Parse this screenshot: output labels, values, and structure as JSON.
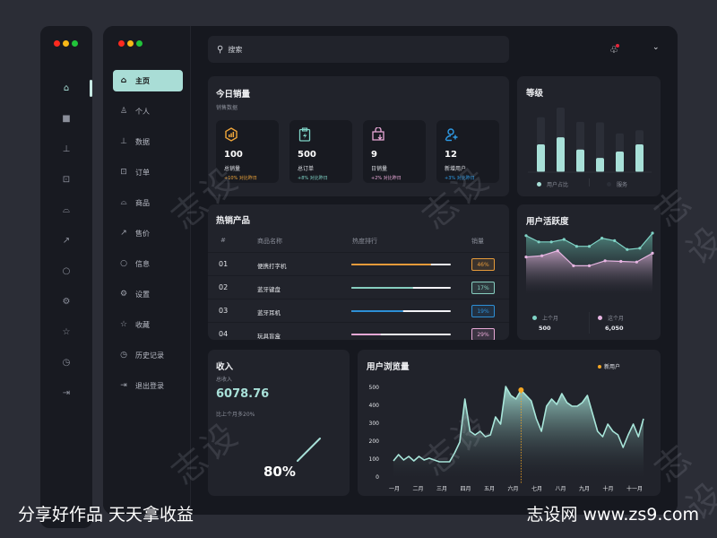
{
  "window_controls": {
    "colors": [
      "#ff2a1f",
      "#f7b817",
      "#21c43a"
    ]
  },
  "mini_sidebar": {
    "items": [
      {
        "icon": "home-icon",
        "glyph": "⌂",
        "active": true
      },
      {
        "icon": "square-icon",
        "glyph": "■"
      },
      {
        "icon": "chart-bar-icon",
        "glyph": "⊥"
      },
      {
        "icon": "cart-icon",
        "glyph": "⊡"
      },
      {
        "icon": "bag-icon",
        "glyph": "⌓"
      },
      {
        "icon": "line-chart-icon",
        "glyph": "↗"
      },
      {
        "icon": "message-icon",
        "glyph": "○"
      },
      {
        "icon": "settings-icon",
        "glyph": "⚙"
      },
      {
        "icon": "star-icon",
        "glyph": "☆"
      },
      {
        "icon": "history-icon",
        "glyph": "◷"
      },
      {
        "icon": "logout-icon",
        "glyph": "⇥"
      }
    ]
  },
  "sidebar": {
    "items": [
      {
        "label": "主页",
        "icon": "home-icon",
        "glyph": "⌂",
        "active": true
      },
      {
        "label": "个人",
        "icon": "user-icon",
        "glyph": "♙"
      },
      {
        "label": "数据",
        "icon": "chart-bar-icon",
        "glyph": "⊥"
      },
      {
        "label": "订单",
        "icon": "cart-icon",
        "glyph": "⊡"
      },
      {
        "label": "商品",
        "icon": "bag-icon",
        "glyph": "⌓"
      },
      {
        "label": "售价",
        "icon": "line-chart-icon",
        "glyph": "↗"
      },
      {
        "label": "信息",
        "icon": "message-icon",
        "glyph": "○"
      },
      {
        "label": "设置",
        "icon": "settings-icon",
        "glyph": "⚙"
      },
      {
        "label": "收藏",
        "icon": "star-icon",
        "glyph": "☆"
      },
      {
        "label": "历史记录",
        "icon": "history-icon",
        "glyph": "◷"
      },
      {
        "label": "退出登录",
        "icon": "logout-icon",
        "glyph": "⇥"
      }
    ]
  },
  "topbar": {
    "search_placeholder": "搜索",
    "search_glyph": "⚲",
    "bell_glyph": "🔔",
    "chevron_glyph": "⌄"
  },
  "today_sales": {
    "title": "今日销量",
    "subtitle": "销售数据",
    "stats": [
      {
        "value": "100",
        "label": "总销量",
        "change": "+10% 对比昨日",
        "color": "#f0a63a",
        "icon": "hexagon-chart-icon"
      },
      {
        "value": "500",
        "label": "总订单",
        "change": "+8% 对比昨日",
        "color": "#7fd3c6",
        "icon": "clipboard-bolt-icon"
      },
      {
        "value": "9",
        "label": "日销量",
        "change": "+2% 对比昨日",
        "color": "#e9a9d8",
        "icon": "shopping-bag-icon"
      },
      {
        "value": "12",
        "label": "新增用户",
        "change": "+3% 对比昨日",
        "color": "#2e9be6",
        "icon": "add-user-icon"
      }
    ]
  },
  "level": {
    "title": "等级",
    "legend": [
      "用户占比",
      "服务"
    ],
    "colors": {
      "primary": "#a8e0d8",
      "secondary": "#2b2e37"
    },
    "chart_data": {
      "type": "bar",
      "series": [
        {
          "name": "用户占比",
          "values": [
            43,
            54,
            35,
            22,
            32,
            43
          ]
        },
        {
          "name": "服务",
          "values": [
            85,
            100,
            78,
            77,
            60,
            65
          ]
        }
      ]
    }
  },
  "hot_products": {
    "title": "热销产品",
    "columns": [
      "#",
      "商品名称",
      "热度排行",
      "销量"
    ],
    "rows": [
      {
        "num": "01",
        "name": "便携打字机",
        "popularity": 0.8,
        "sales": "46%",
        "color": "#e59a3a"
      },
      {
        "num": "02",
        "name": "蓝牙键盘",
        "popularity": 0.62,
        "sales": "17%",
        "color": "#86cdbf"
      },
      {
        "num": "03",
        "name": "蓝牙耳机",
        "popularity": 0.52,
        "sales": "19%",
        "color": "#2d8fd6"
      },
      {
        "num": "04",
        "name": "玩具盲盒",
        "popularity": 0.3,
        "sales": "29%",
        "color": "#e7a8d6"
      }
    ]
  },
  "activity": {
    "title": "用户活跃度",
    "legend": [
      {
        "label": "上个月",
        "value": "500",
        "color": "#7fd3c6"
      },
      {
        "label": "这个月",
        "value": "6,050",
        "color": "#e7b5e2"
      }
    ],
    "chart_data": {
      "type": "area",
      "series": [
        {
          "name": "上个月",
          "values": [
            86,
            76,
            76,
            80,
            69,
            69,
            82,
            78,
            64,
            66,
            90
          ]
        },
        {
          "name": "这个月",
          "values": [
            52,
            54,
            62,
            38,
            38,
            46,
            45,
            44,
            58
          ]
        }
      ]
    }
  },
  "income": {
    "title": "收入",
    "subtitle": "总收入",
    "value": "6078.76",
    "note": "比上个月多20%",
    "percent": "80%",
    "progress": 0.8
  },
  "browse": {
    "title": "用户浏览量",
    "legend": "新用户",
    "highlight_color": "#f5a623",
    "line_color": "#a8e6da",
    "chart_data": {
      "type": "area",
      "title": "用户浏览量",
      "x": [
        "一月",
        "二月",
        "三月",
        "四月",
        "五月",
        "六月",
        "七月",
        "八月",
        "九月",
        "十月",
        "十一月"
      ],
      "yticks": [
        0,
        100,
        200,
        300,
        400,
        500
      ],
      "ylim": [
        0,
        550
      ],
      "values": [
        95,
        130,
        100,
        120,
        95,
        120,
        100,
        110,
        100,
        90,
        90,
        90,
        140,
        200,
        440,
        260,
        240,
        260,
        230,
        240,
        340,
        300,
        510,
        460,
        440,
        490,
        460,
        430,
        330,
        260,
        400,
        440,
        410,
        470,
        420,
        400,
        400,
        420,
        460,
        360,
        260,
        230,
        300,
        260,
        240,
        170,
        240,
        300,
        230,
        330
      ],
      "highlight_index": 25,
      "highlight_label": "新用户"
    }
  },
  "footer": {
    "left": "分享好作品 天天拿收益",
    "right": "志设网 www.zs9.com"
  },
  "watermark": "志设"
}
